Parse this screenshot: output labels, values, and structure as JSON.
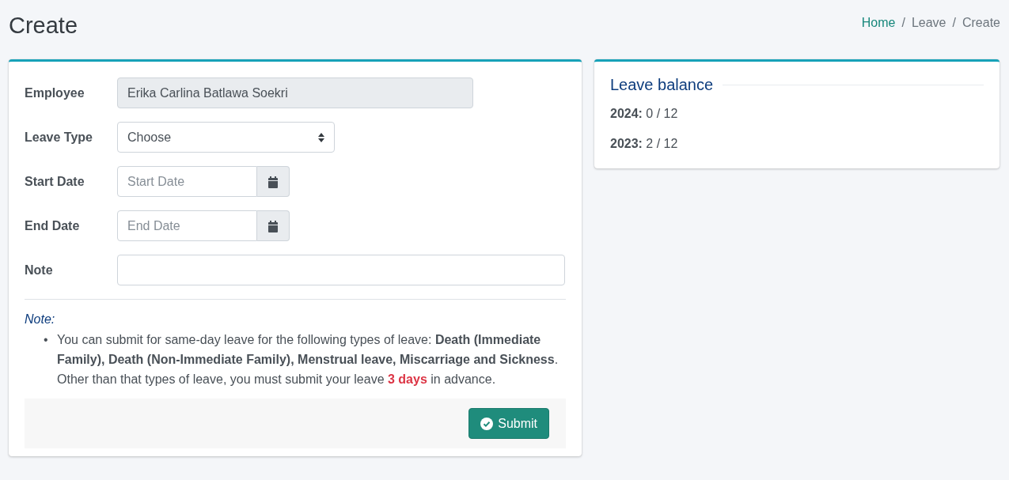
{
  "page_title": "Create",
  "breadcrumb": [
    {
      "label": "Home",
      "link": true
    },
    {
      "separator": "/",
      "label": "Leave",
      "link": false
    },
    {
      "separator": "/",
      "label": "Create",
      "link": false
    }
  ],
  "form": {
    "fields": [
      {
        "label": "Employee",
        "kind": "readonly",
        "value": "Erika Carlina Batlawa Soekri"
      },
      {
        "label": "Leave Type",
        "kind": "select",
        "value": "Choose"
      },
      {
        "label": "Start Date",
        "kind": "date",
        "placeholder": "Start Date"
      },
      {
        "label": "End Date",
        "kind": "date",
        "placeholder": "End Date"
      },
      {
        "label": "Note",
        "kind": "text"
      }
    ],
    "note_heading": "Note:",
    "note_items": [
      {
        "bullet": "•",
        "segments": [
          {
            "kind": "text",
            "text": "You can submit for same-day leave for the following types of leave: "
          },
          {
            "kind": "bold",
            "text": "Death (Immediate Family), Death (Non-Immediate Family), Menstrual leave, Miscarriage and Sickness"
          },
          {
            "kind": "text",
            "text": ". Other than that types of leave, you must submit your leave "
          },
          {
            "kind": "alert",
            "text": "3 days"
          },
          {
            "kind": "text",
            "text": " in advance."
          }
        ]
      }
    ],
    "submit": "Submit"
  },
  "leave_balance": {
    "title": "Leave balance",
    "rows": [
      "**2024:** 0 / 12",
      "**2023:** 2 / 12"
    ]
  }
}
